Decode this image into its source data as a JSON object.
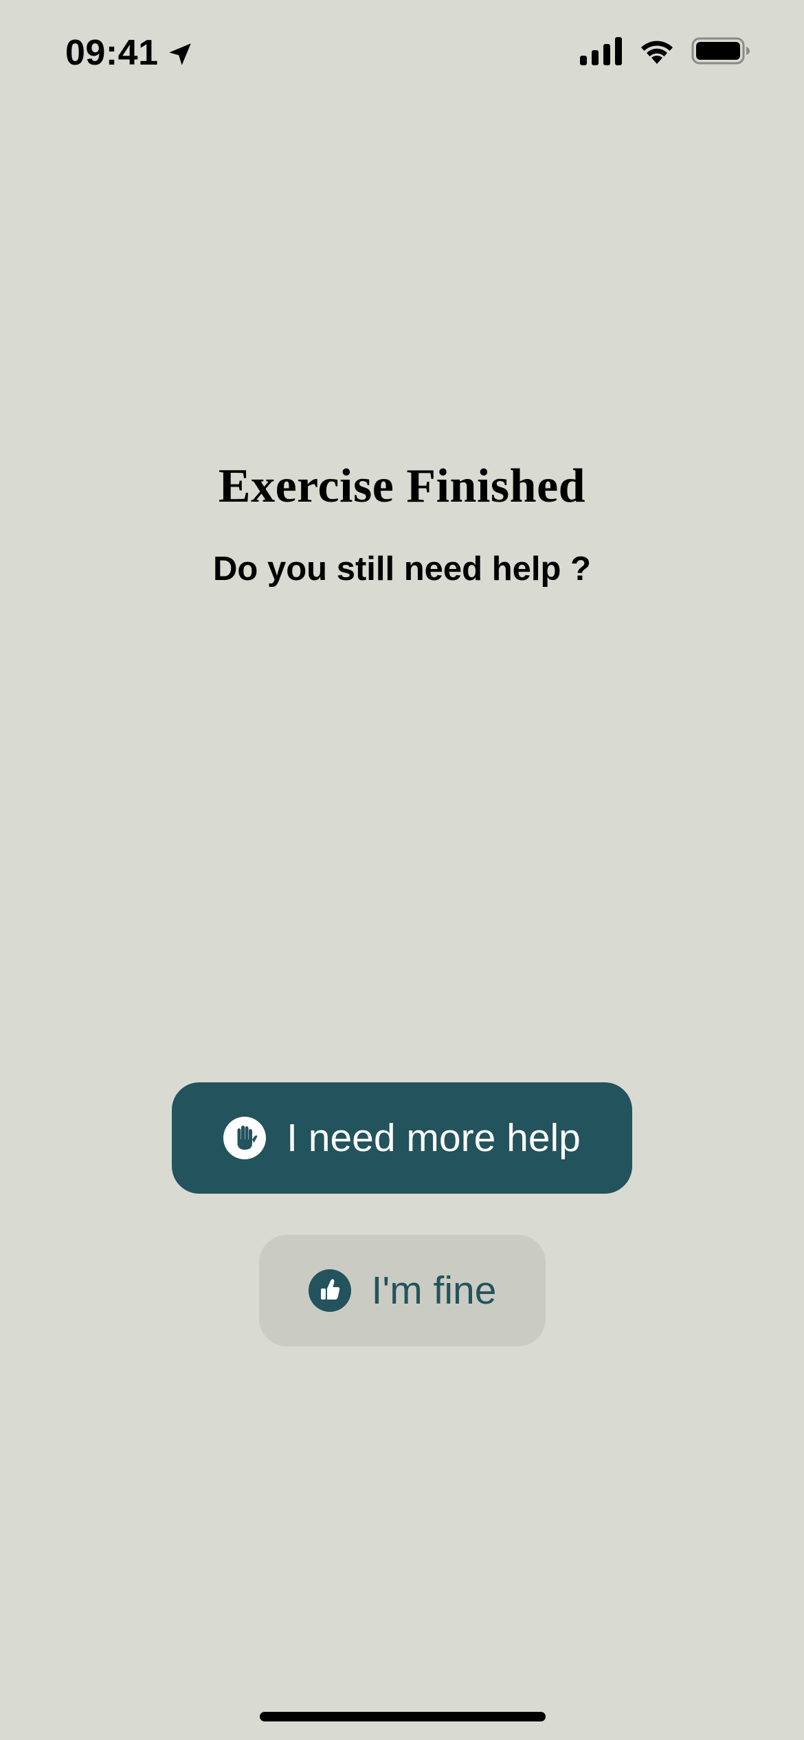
{
  "status_bar": {
    "time": "09:41",
    "icons": [
      "location-arrow-icon",
      "cellular-signal-icon",
      "wifi-icon",
      "battery-icon"
    ]
  },
  "screen": {
    "title": "Exercise Finished",
    "subtitle": "Do you still need help ?"
  },
  "actions": {
    "need_help": {
      "label": "I need more help",
      "icon": "raised-hand-icon",
      "background": "#23535d",
      "text_color": "#ffffff"
    },
    "fine": {
      "label": "I'm fine",
      "icon": "thumbs-up-icon",
      "background": "#cacbc3",
      "text_color": "#23535d"
    }
  },
  "colors": {
    "page_background": "#d9dad2",
    "accent": "#23535d"
  }
}
